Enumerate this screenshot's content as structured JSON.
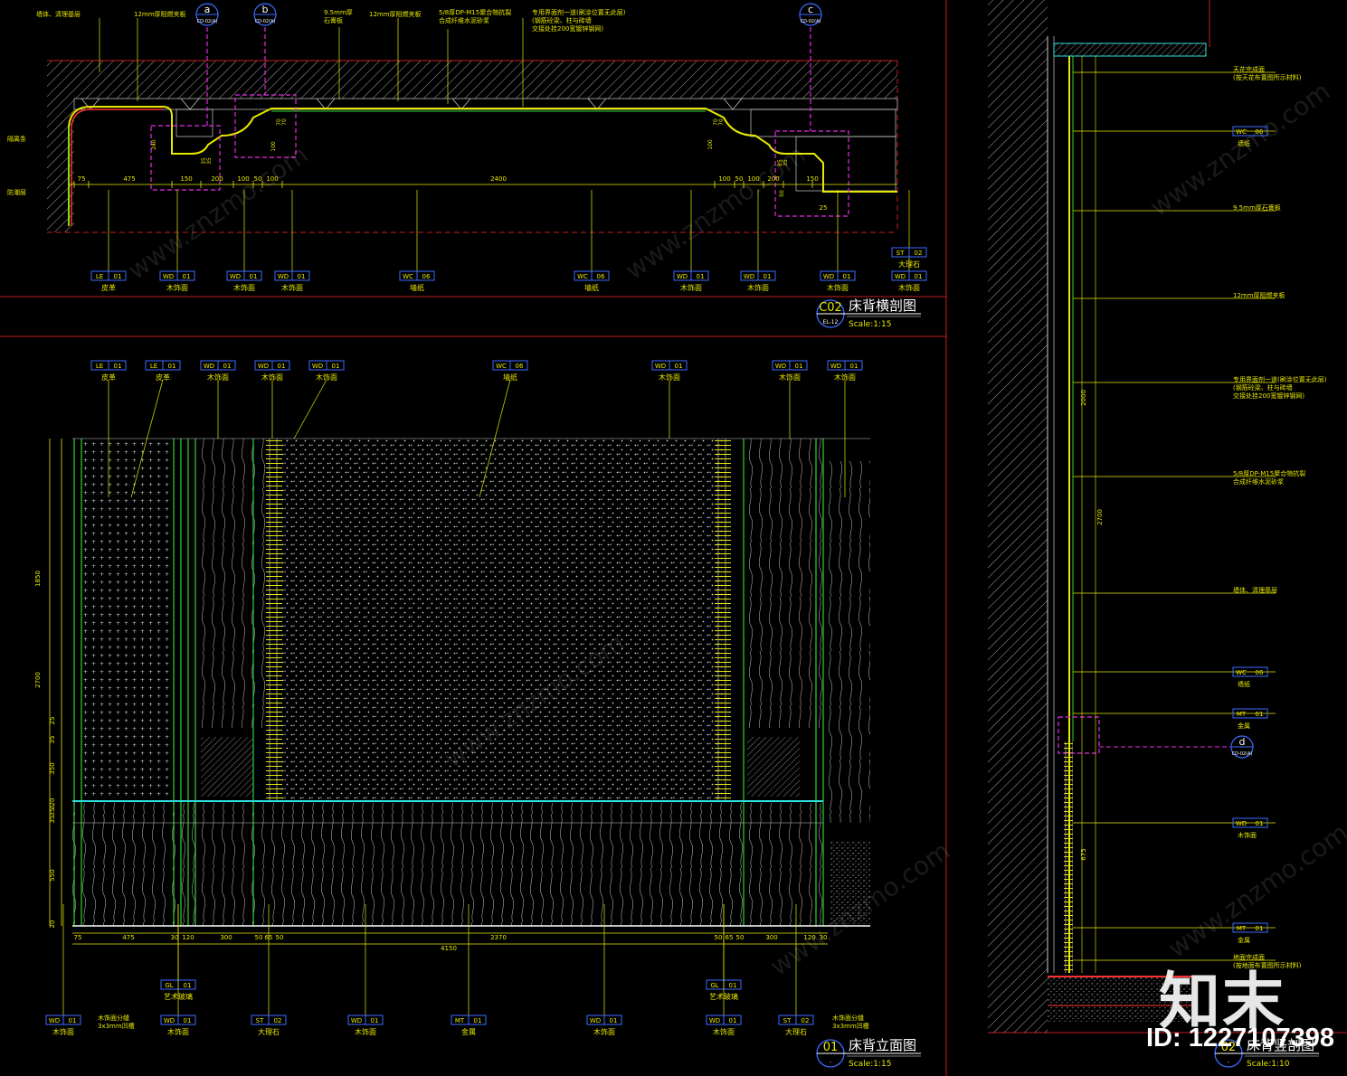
{
  "views": {
    "plan": {
      "number": "C02",
      "sheet": "EL-12",
      "title": "床背横剖图",
      "scale": "Scale:1:15"
    },
    "elevation": {
      "number": "01",
      "sheet": "-",
      "title": "床背立面图",
      "scale": "Scale:1:15"
    },
    "section": {
      "number": "02",
      "sheet": "-",
      "title": "床背竖剖图",
      "scale": "Scale:1:10"
    }
  },
  "plan_top_notes": [
    "墙体、清理基层",
    "12mm厚阻燃夹板",
    "9.5mm厚\n石膏板",
    "12mm厚阻燃夹板",
    "5/8厚DP-M15聚合物抗裂\n合成纤维水泥砂浆",
    "专用界面剂一道(刷涂位置无此层)\n(钢筋砼梁、柱与砖墙\n交接处挂200宽镀锌钢网)"
  ],
  "plan_left_notes": [
    "隔离条",
    "防潮层"
  ],
  "detail_callouts": [
    {
      "letter": "a",
      "ref": "CD-02(A)"
    },
    {
      "letter": "b",
      "ref": "CD-02(A)"
    },
    {
      "letter": "c",
      "ref": "CD-02(A)"
    },
    {
      "letter": "d",
      "ref": "CD-02(A)"
    }
  ],
  "plan_dims": [
    "75",
    "475",
    "150",
    "200",
    "100",
    "50",
    "100",
    "2400",
    "100",
    "50",
    "100",
    "200",
    "150",
    "25"
  ],
  "plan_small_dims": [
    "240",
    "35",
    "35",
    "100",
    "70",
    "70",
    "100",
    "70",
    "70",
    "85",
    "35",
    "50"
  ],
  "plan_tags": [
    {
      "code": "LE",
      "num": "01",
      "label": "皮革"
    },
    {
      "code": "WD",
      "num": "01",
      "label": "木饰面"
    },
    {
      "code": "WD",
      "num": "01",
      "label": "木饰面"
    },
    {
      "code": "WD",
      "num": "01",
      "label": "木饰面"
    },
    {
      "code": "WC",
      "num": "06",
      "label": "墙纸"
    },
    {
      "code": "WC",
      "num": "06",
      "label": "墙纸"
    },
    {
      "code": "WD",
      "num": "01",
      "label": "木饰面"
    },
    {
      "code": "WD",
      "num": "01",
      "label": "木饰面"
    },
    {
      "code": "WD",
      "num": "01",
      "label": "木饰面"
    },
    {
      "code": "WD",
      "num": "01",
      "label": "木饰面"
    },
    {
      "code": "ST",
      "num": "02",
      "label": "大理石"
    }
  ],
  "elev_top_tags": [
    {
      "code": "LE",
      "num": "01",
      "label": "皮革"
    },
    {
      "code": "LE",
      "num": "01",
      "label": "皮革"
    },
    {
      "code": "WD",
      "num": "01",
      "label": "木饰面"
    },
    {
      "code": "WD",
      "num": "01",
      "label": "木饰面"
    },
    {
      "code": "WD",
      "num": "01",
      "label": "木饰面"
    },
    {
      "code": "WC",
      "num": "06",
      "label": "墙纸"
    },
    {
      "code": "WD",
      "num": "01",
      "label": "木饰面"
    },
    {
      "code": "WD",
      "num": "01",
      "label": "木饰面"
    },
    {
      "code": "WD",
      "num": "01",
      "label": "木饰面"
    }
  ],
  "elev_bottom_tags": [
    {
      "code": "WD",
      "num": "01",
      "label": "木饰面"
    },
    {
      "code": "GL",
      "num": "01",
      "label": "艺术玻璃"
    },
    {
      "code": "WD",
      "num": "01",
      "label": "木饰面"
    },
    {
      "code": "ST",
      "num": "02",
      "label": "大理石"
    },
    {
      "code": "WD",
      "num": "01",
      "label": "木饰面"
    },
    {
      "code": "MT",
      "num": "01",
      "label": "金属"
    },
    {
      "code": "WD",
      "num": "01",
      "label": "木饰面"
    },
    {
      "code": "GL",
      "num": "01",
      "label": "艺术玻璃"
    },
    {
      "code": "WD",
      "num": "01",
      "label": "木饰面"
    },
    {
      "code": "ST",
      "num": "02",
      "label": "大理石"
    }
  ],
  "elev_groove_notes": [
    "木饰面分缝\n3x3mm凹槽",
    "木饰面分缝\n3x3mm凹槽"
  ],
  "elev_vert_dims": [
    "1850",
    "2700",
    "25",
    "35",
    "350",
    "20",
    "3",
    "35",
    "35",
    "550",
    "20"
  ],
  "elev_bottom_dims": [
    "75",
    "475",
    "30",
    "120",
    "300",
    "50",
    "65",
    "50",
    "2370",
    "50",
    "65",
    "50",
    "300",
    "120",
    "30"
  ],
  "elev_total_dim": "4150",
  "section_notes": [
    {
      "code": "",
      "num": "",
      "label": "天花完成面\n(按天花布置图所示材料)"
    },
    {
      "code": "WC",
      "num": "06",
      "label": "墙纸"
    },
    {
      "code": "",
      "num": "",
      "label": "9.5mm厚石膏板"
    },
    {
      "code": "",
      "num": "",
      "label": "12mm厚阻燃夹板"
    },
    {
      "code": "",
      "num": "",
      "label": "专用界面剂一道(刷涂位置无此层)\n(钢筋砼梁、柱与砖墙\n交接处挂200宽镀锌钢网)"
    },
    {
      "code": "",
      "num": "",
      "label": "5/8厚DP-M15聚合物抗裂\n合成纤维水泥砂浆"
    },
    {
      "code": "",
      "num": "",
      "label": "墙体、清理基层"
    },
    {
      "code": "WC",
      "num": "06",
      "label": "墙纸"
    },
    {
      "code": "MT",
      "num": "01",
      "label": "金属"
    },
    {
      "code": "WD",
      "num": "01",
      "label": "木饰面"
    },
    {
      "code": "MT",
      "num": "01",
      "label": "金属"
    },
    {
      "code": "",
      "num": "",
      "label": "地面完成面\n(按地面布置图所示材料)"
    }
  ],
  "section_dims": [
    "2000",
    "2700",
    "675"
  ],
  "watermark": {
    "logo": "知末",
    "id": "ID: 1227107398",
    "site": "www.znzmo.com"
  }
}
